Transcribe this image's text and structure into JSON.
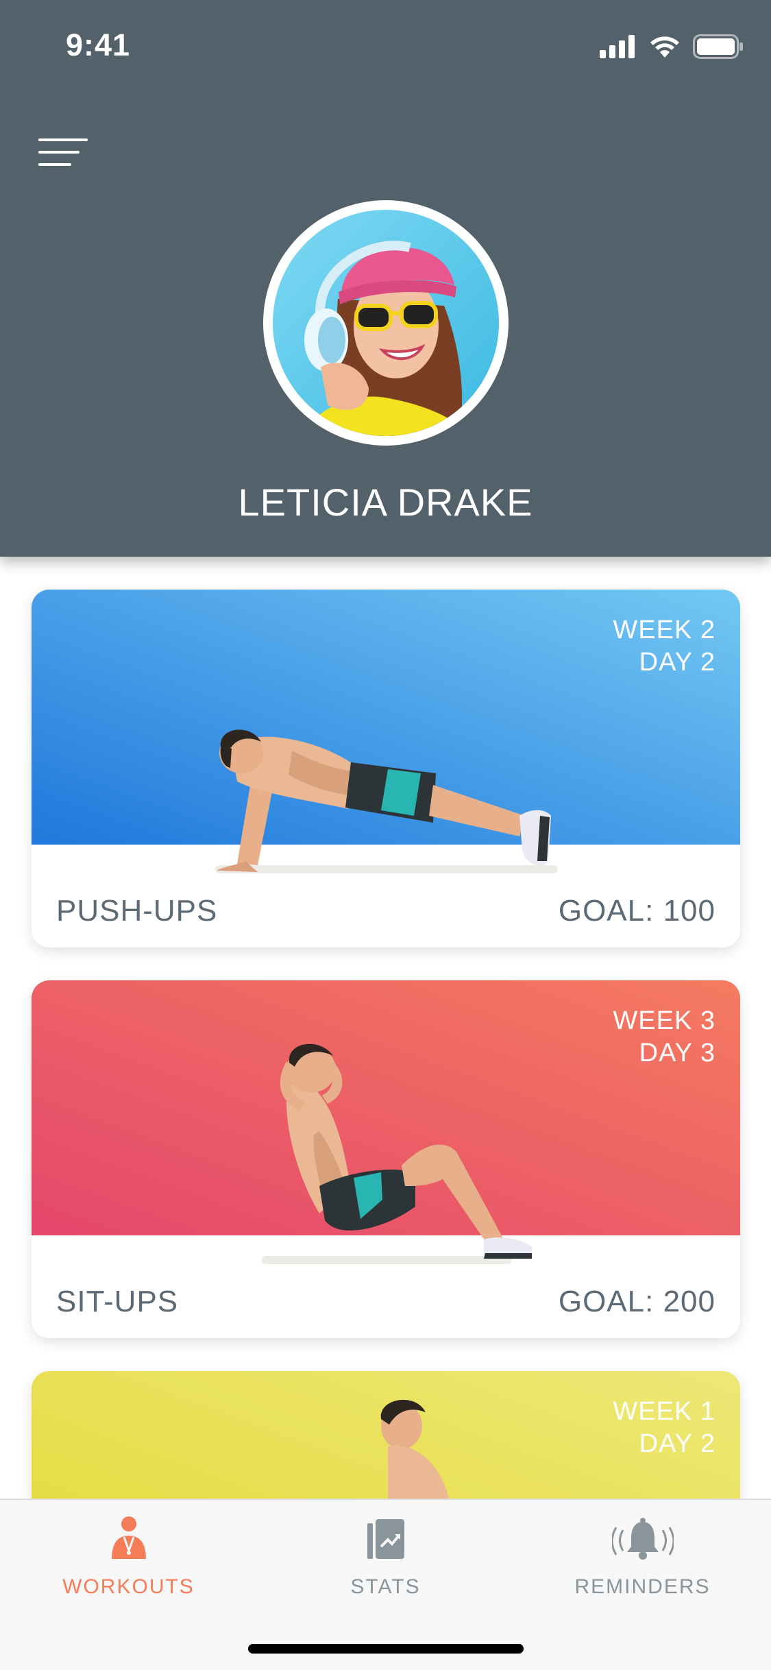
{
  "status_bar": {
    "time": "9:41"
  },
  "profile": {
    "name": "LETICIA DRAKE"
  },
  "workouts": [
    {
      "name": "PUSH-UPS",
      "goal": "GOAL: 100",
      "week": "WEEK 2",
      "day": "DAY 2",
      "gradient": [
        "#1f78dc",
        "#74c8f3"
      ]
    },
    {
      "name": "SIT-UPS",
      "goal": "GOAL: 200",
      "week": "WEEK 3",
      "day": "DAY 3",
      "gradient": [
        "#e4476c",
        "#f57b60"
      ]
    },
    {
      "name": "",
      "goal": "",
      "week": "WEEK 1",
      "day": "DAY 2",
      "gradient": [
        "#e4d935",
        "#ede877"
      ]
    }
  ],
  "tabbar": {
    "active_color": "#f47c57",
    "inactive_color": "#8a949b",
    "tabs": [
      {
        "label": "WORKOUTS",
        "icon": "trainer-icon",
        "active": true
      },
      {
        "label": "STATS",
        "icon": "chart-icon",
        "active": false
      },
      {
        "label": "REMINDERS",
        "icon": "bell-icon",
        "active": false
      }
    ]
  }
}
